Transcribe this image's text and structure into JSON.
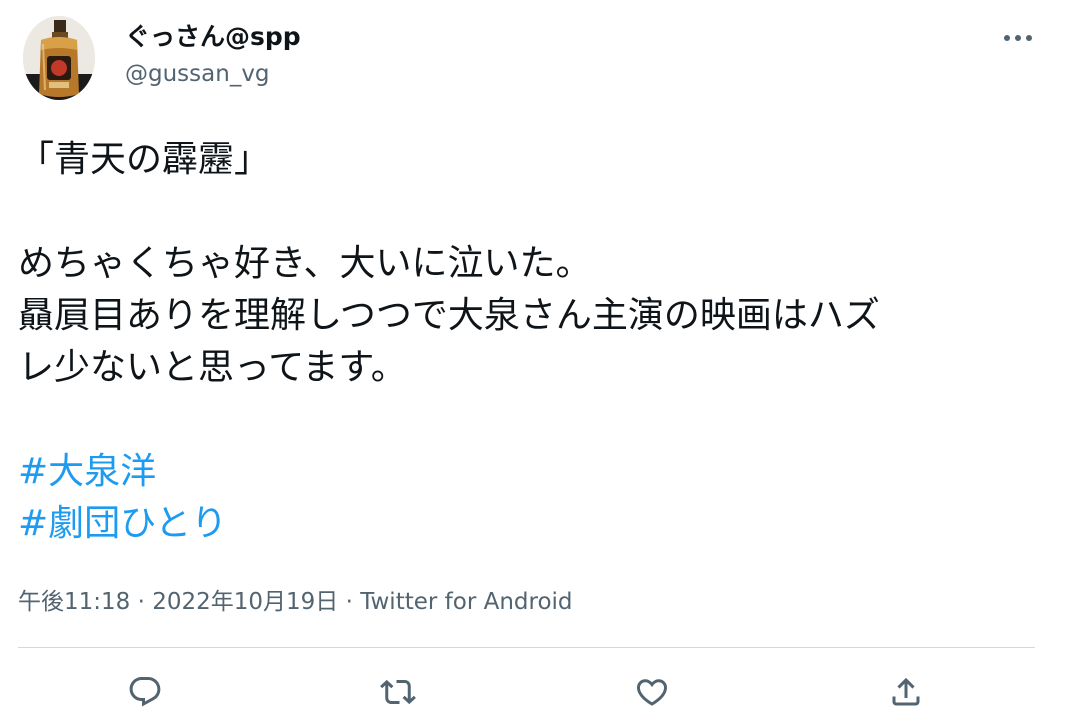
{
  "author": {
    "display_name": "ぐっさん@spp",
    "handle": "@gussan_vg",
    "avatar_icon": "whisky-bottle-avatar"
  },
  "tweet": {
    "lines": [
      "「青天の霹靂」",
      "",
      "めちゃくちゃ好き、大いに泣いた。",
      "贔屓目ありを理解しつつで大泉さん主演の映画はハズ",
      "レ少ないと思ってます。",
      ""
    ],
    "hashtags": [
      "#大泉洋",
      "#劇団ひとり"
    ]
  },
  "meta": {
    "time": "午後11:18",
    "separator": " · ",
    "date": "2022年10月19日",
    "source": "Twitter for Android"
  },
  "actions": {
    "reply_icon": "reply-icon",
    "retweet_icon": "retweet-icon",
    "like_icon": "heart-icon",
    "share_icon": "share-icon"
  },
  "colors": {
    "text": "#0f1419",
    "secondary": "#536471",
    "link": "#1d9bf0",
    "divider": "#cfd9de"
  }
}
